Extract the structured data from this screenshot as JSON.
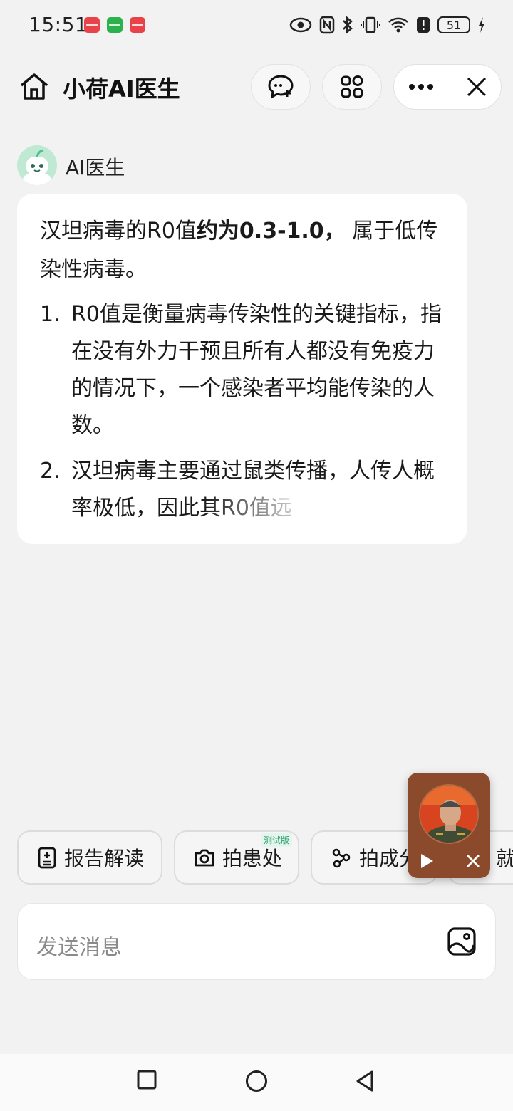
{
  "status_bar": {
    "time": "15:51",
    "battery": "51"
  },
  "header": {
    "title": "小荷AI医生"
  },
  "assistant": {
    "name": "AI医生"
  },
  "message": {
    "intro_a": "汉坦病毒的R0值",
    "intro_bold": "约为0.3-1.0，",
    "intro_b": " 属于低传染性病毒。",
    "items": [
      {
        "num": "1.",
        "text": "R0值是衡量病毒传染性的关键指标，指在没有外力干预且所有人都没有免疫力的情况下，一个感染者平均能传染的人数。"
      },
      {
        "num": "2.",
        "text_a": "汉坦病毒主要通过鼠类传播，人传人概率极低，",
        "text_b": "因此其R0值远"
      }
    ]
  },
  "quick_actions": [
    {
      "label": "报告解读",
      "icon": "report-icon"
    },
    {
      "label": "拍患处",
      "icon": "camera-icon",
      "badge": "测试版"
    },
    {
      "label": "拍成分",
      "icon": "molecule-icon"
    },
    {
      "label": "就",
      "icon": ""
    }
  ],
  "input": {
    "placeholder": "发送消息"
  },
  "colors": {
    "background": "#f2f2f3",
    "bubble": "#ffffff",
    "accent_green": "#2a9d6a"
  }
}
